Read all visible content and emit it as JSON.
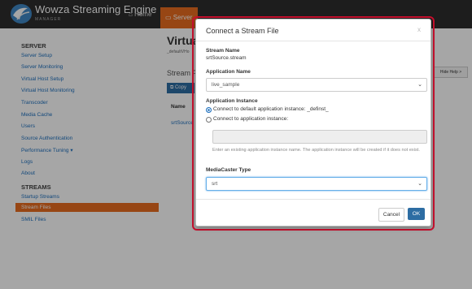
{
  "app": {
    "brand": "Wowza Streaming Engine",
    "brand_sub": "MANAGER"
  },
  "nav": {
    "home": "Home",
    "server": "Server"
  },
  "sidebar": {
    "server_header": "SERVER",
    "items": [
      "Server Setup",
      "Server Monitoring",
      "Virtual Host Setup",
      "Virtual Host Monitoring",
      "Transcoder",
      "Media Cache",
      "Users",
      "Source Authentication",
      "Performance Tuning ▾",
      "Logs",
      "About"
    ],
    "streams_header": "STREAMS",
    "stream_items": [
      "Startup Streams",
      "Stream Files",
      "SMIL Files"
    ]
  },
  "main": {
    "title": "Virtua",
    "subtitle": "_defaultVHo",
    "section": "Stream F",
    "copy_button": "Copy",
    "column_name": "Name",
    "row_name": "srtSource",
    "hide_help": "Hide Help >"
  },
  "modal": {
    "title": "Connect a Stream File",
    "close": "x",
    "stream_name_label": "Stream Name",
    "stream_name_value": "srtSource.stream",
    "app_name_label": "Application Name",
    "app_name_value": "live_sample",
    "app_instance_label": "Application Instance",
    "radio_default": "Connect to default application instance: _definst_",
    "radio_custom": "Connect to application instance:",
    "help_text": "Enter an existing application instance name. The application instance will be created if it does not exist.",
    "mediacaster_label": "MediaCaster Type",
    "mediacaster_value": "srt",
    "cancel": "Cancel",
    "ok": "OK"
  }
}
